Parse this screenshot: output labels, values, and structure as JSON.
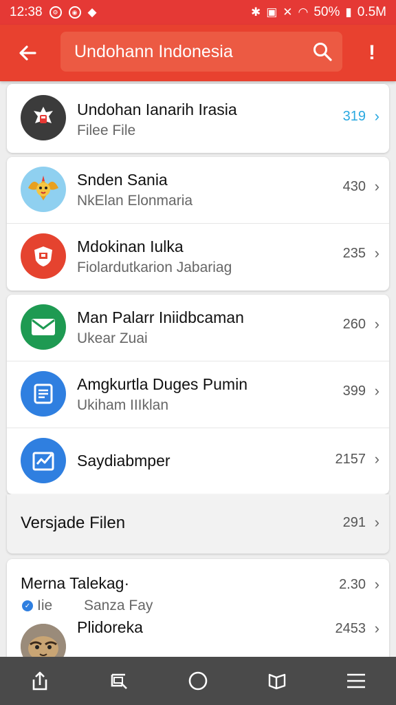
{
  "status_bar": {
    "time": "12:38",
    "battery": "50%",
    "speed": "0.5M"
  },
  "app_bar": {
    "search_text": "Undohann Indonesia",
    "back_icon": "arrow-left-icon",
    "search_icon": "search-icon",
    "overflow_symbol": "!"
  },
  "items": [
    {
      "title": "Undohan Ianarih Irasia",
      "subtitle": "Filee File",
      "count": "319",
      "count_color": "#29a8e0",
      "avatar_color": "#3b3b3b",
      "avatar_icon": "garuda-emblem-icon"
    },
    {
      "title": "Snden Sania",
      "subtitle": "NkElan Elonmaria",
      "count": "430",
      "avatar_color": "#8fd0f0",
      "avatar_icon": "garuda-mascot-icon"
    },
    {
      "title": "Mdokinan Iulka",
      "subtitle": "Fiolardutkarion Jabariag",
      "count": "235",
      "avatar_color": "#e5432f",
      "avatar_icon": "shield-icon"
    },
    {
      "title": "Man Palarr Iniidbcaman",
      "subtitle": "Ukear Zuai",
      "count": "260",
      "avatar_color": "#1e9a52",
      "avatar_icon": "mail-icon"
    },
    {
      "title": "Amgkurtla Duges Pumin",
      "subtitle": "Ukiham IIIklan",
      "count": "399",
      "avatar_color": "#2f7fe0",
      "avatar_icon": "document-icon"
    },
    {
      "title": "Saydiabmper",
      "subtitle": "",
      "count": "2157",
      "avatar_color": "#2f7fe0",
      "avatar_icon": "chart-check-icon"
    }
  ],
  "versions": {
    "label": "Versjade Filen",
    "count": "291"
  },
  "more_items": [
    {
      "title": "Merna Talekag·",
      "subtitle_prefix": "Iie",
      "subtitle": "Sanza Fay",
      "count": "2.30"
    },
    {
      "title": "Plidoreka",
      "subtitle": "",
      "count": "2453",
      "avatar_color": "#9a8b7a",
      "avatar_icon": "tiger-photo-icon"
    }
  ],
  "nav_icons": [
    "share-icon",
    "tab-switch-icon",
    "home-circle-icon",
    "book-icon",
    "menu-icon"
  ]
}
